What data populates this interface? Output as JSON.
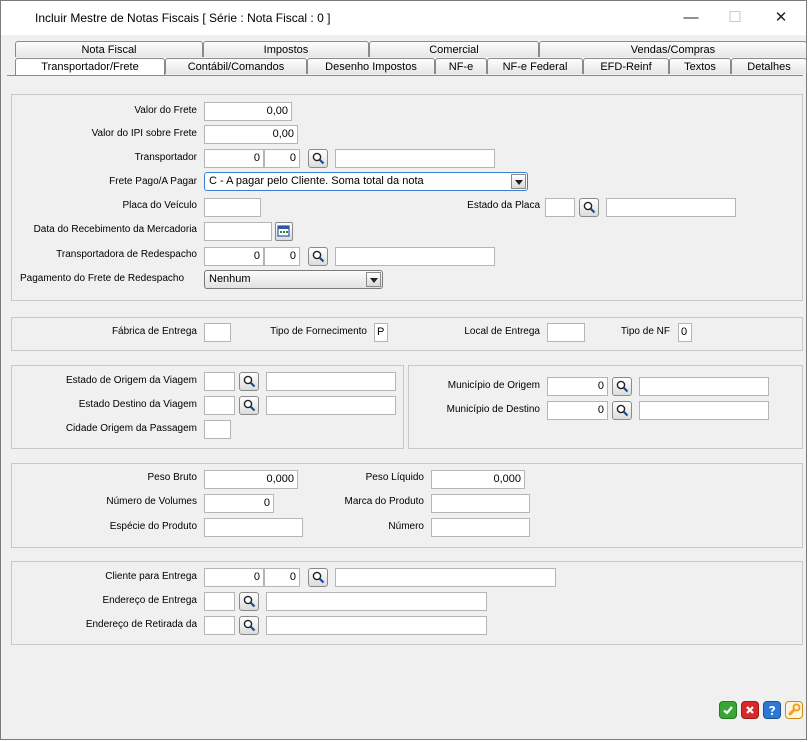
{
  "window": {
    "title": "Incluir Mestre de Notas Fiscais [ Série :    Nota Fiscal : 0 ]",
    "minimize": "—",
    "maximize": "☐",
    "close": "✕"
  },
  "tabs_top": [
    "Nota Fiscal",
    "Impostos",
    "Comercial",
    "Vendas/Compras"
  ],
  "tabs_bottom": [
    "Transportador/Frete",
    "Contábil/Comandos",
    "Desenho Impostos",
    "NF-e",
    "NF-e Federal",
    "EFD-Reinf",
    "Textos",
    "Detalhes"
  ],
  "frete": {
    "valor_frete_label": "Valor do Frete",
    "valor_frete": "0,00",
    "valor_ipi_label": "Valor do IPI sobre Frete",
    "valor_ipi": "0,00",
    "transportador_label": "Transportador",
    "transportador_cod1": "0",
    "transportador_cod2": "0",
    "transportador_nome": "",
    "frete_pago_label": "Frete Pago/A Pagar",
    "frete_pago_value": "C - A pagar pelo Cliente. Soma total da nota",
    "placa_label": "Placa do Veículo",
    "placa": "",
    "estado_placa_label": "Estado da Placa",
    "estado_placa": "",
    "estado_placa_nome": "",
    "data_receb_label": "Data do Recebimento da Mercadoria",
    "data_receb": "",
    "transp_redespacho_label": "Transportadora de Redespacho",
    "transp_redespacho_cod1": "0",
    "transp_redespacho_cod2": "0",
    "transp_redespacho_nome": "",
    "pagamento_redespacho_label": "Pagamento do Frete de Redespacho",
    "pagamento_redespacho_value": "Nenhum"
  },
  "fabrica": {
    "fabrica_label": "Fábrica de Entrega",
    "fabrica": "",
    "tipo_fornecimento_label": "Tipo de Fornecimento",
    "tipo_fornecimento": "P",
    "local_entrega_label": "Local de Entrega",
    "local_entrega": "",
    "tipo_nf_label": "Tipo de NF",
    "tipo_nf": "0"
  },
  "viagem": {
    "estado_origem_label": "Estado de Origem da Viagem",
    "estado_origem": "",
    "estado_origem_nome": "",
    "estado_destino_label": "Estado Destino da Viagem",
    "estado_destino": "",
    "estado_destino_nome": "",
    "cidade_passagem_label": "Cidade Origem da Passagem",
    "cidade_passagem": "",
    "municipio_origem_label": "Município de Origem",
    "municipio_origem": "0",
    "municipio_origem_nome": "",
    "municipio_destino_label": "Município de Destino",
    "municipio_destino": "0",
    "municipio_destino_nome": ""
  },
  "peso": {
    "peso_bruto_label": "Peso Bruto",
    "peso_bruto": "0,000",
    "peso_liquido_label": "Peso Líquido",
    "peso_liquido": "0,000",
    "num_volumes_label": "Número de Volumes",
    "num_volumes": "0",
    "marca_label": "Marca do Produto",
    "marca": "",
    "especie_label": "Espécie do Produto",
    "especie": "",
    "numero_label": "Número",
    "numero": ""
  },
  "entrega": {
    "cliente_label": "Cliente para Entrega",
    "cliente_cod1": "0",
    "cliente_cod2": "0",
    "cliente_nome": "",
    "endereco_entrega_label": "Endereço de Entrega",
    "endereco_entrega": "",
    "endereco_entrega_desc": "",
    "endereco_retirada_label": "Endereço de Retirada da",
    "endereco_retirada": "",
    "endereco_retirada_desc": ""
  },
  "colors": {
    "ok": "#3aa635",
    "cancel": "#d62a2a",
    "help": "#2d78d6",
    "tools": "#f0a020"
  }
}
